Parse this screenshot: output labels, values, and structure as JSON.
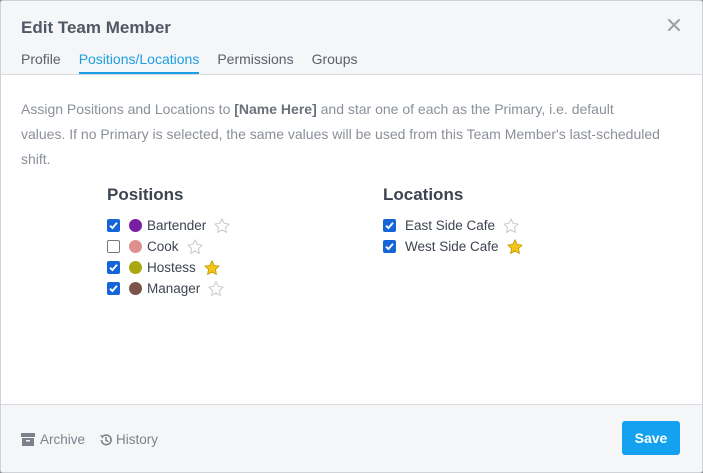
{
  "dialog": {
    "title": "Edit Team Member"
  },
  "tabs": [
    {
      "label": "Profile"
    },
    {
      "label": "Positions/Locations"
    },
    {
      "label": "Permissions"
    },
    {
      "label": "Groups"
    }
  ],
  "description": {
    "before": "Assign Positions and Locations to ",
    "name_placeholder": "[Name Here]",
    "after": " and star one of each as the Primary, i.e. default values. If no Primary is selected, the same values will be used from this Team Member's last-scheduled shift."
  },
  "positions": {
    "heading": "Positions",
    "items": [
      {
        "label": "Bartender",
        "checked": true,
        "color": "#7b1fa2",
        "primary": false
      },
      {
        "label": "Cook",
        "checked": false,
        "color": "#e08f8f",
        "primary": false
      },
      {
        "label": "Hostess",
        "checked": true,
        "color": "#a8a812",
        "primary": true
      },
      {
        "label": "Manager",
        "checked": true,
        "color": "#7b5348",
        "primary": false
      }
    ]
  },
  "locations": {
    "heading": "Locations",
    "items": [
      {
        "label": "East Side Cafe",
        "checked": true,
        "primary": false
      },
      {
        "label": "West Side Cafe",
        "checked": true,
        "primary": true
      }
    ]
  },
  "footer": {
    "archive_label": "Archive",
    "history_label": "History",
    "save_label": "Save"
  },
  "colors": {
    "accent": "#1d9ee4",
    "save_button": "#14a2f0",
    "checkbox": "#1565d8",
    "star_primary": "#f5c518"
  }
}
